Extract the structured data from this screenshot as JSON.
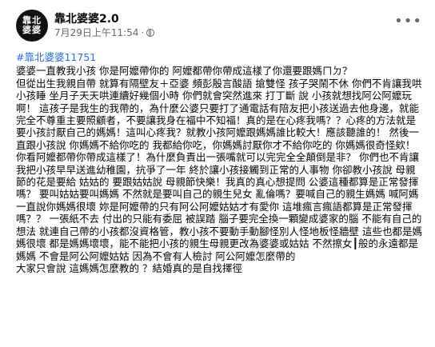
{
  "post": {
    "page_name": "靠北婆婆2.0",
    "avatar_text_line1": "靠北",
    "avatar_text_line2": "婆婆",
    "timestamp": "7月29日上午11:54",
    "separator": "·",
    "privacy_icon": "globe-icon",
    "more_icon": "more-options-icon",
    "hashtag": "#靠北婆婆11751",
    "body": "婆婆一直教我小孩 你是阿嬤帶你的 阿嬤都帶你帶成這樣了你還要跟媽ㄇㄉ？\n但從出生我親自帶 就算有隔壁友＋亞婆 頻彭殷言酸語 搶雙怪 孩子哭鬧不休 你們不肯讓我哄小孩睡 坐月子天天哄連續好幾個小時 你們就會突然進來 打丁斷 說 小孩就想找阿公阿嬤玩啊！ 這孩子是我生的我帶的，為什麼公婆只要打了通電話有陪友把小孩送過去他身邊，就能完全不尊重主要照顧者，不要讓我身在福中不知福！真的是在心疼我嗎？？心疼的方法就是要小孩討厭自己的媽媽！這叫心疼我？就教小孩阿嬤跟媽媽誰比較大！應該聽誰的！ 然後一直跟小孩說 你媽媽不給你吃的 我都給你吃，你媽媽討厭你才不給你吃的 你媽媽很奇怪欸！你看阿嬤都帶你帶成這樣了！為什麼負責出一張嘴就可以完完全全顛倒是非？ 你們也不肯讓我把小孩早早送進幼稚園，抗爭了一年 終於讓小孩接觸到正常的人事物 你卻教小孩說 母親節的花是要給 姑姑的 要跟姑姑說 母親節快樂！我真的真心想提問 公婆這種都算是正常發揮嗎？ 要叫姑姑要叫媽媽 不然就是要叫自己的親生兒女 亂倫嗎？要喊自己的親生媽媽 喊阿媽 一直說你媽媽很壞 妳是阿嬤帶的只有阿公阿嬤姑姑才有愛你 這堆瘋言瘋語都算是正常發揮嗎？？ 一張紙不去 付出的只能有委屈 被誤踏 腦子要完全換一顆變成婆家的腦 不能有自己的想法 就連自己帶的小孩都沒資格管，教小孩不要動手動腳怪別人怪地板怪牆壁 這些也都是媽媽很壞 都是媽媽壞壞，能不能把小孩的親生母親更改為婆婆或姑姑 不然擦女┃般的永遠都是媽媽 不會是阿公阿嬤姑姑 因為不會有人檢討 阿公阿嬤怎麼帶的\n大家只會說 這媽媽怎麼教的 ？結婚真的是自找擇徑"
  }
}
